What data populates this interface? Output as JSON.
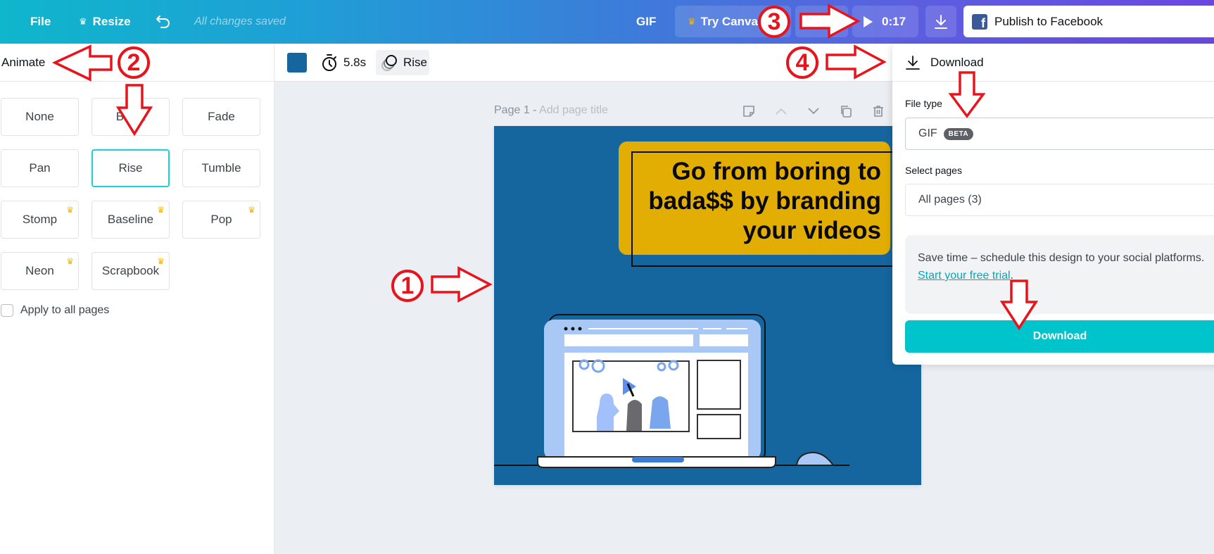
{
  "topbar": {
    "file_label": "File",
    "resize_label": "Resize",
    "save_status": "All changes saved",
    "format_label": "GIF",
    "try_label": "Try Canva Pro",
    "play_time": "0:17",
    "publish_label": "Publish to Facebook",
    "gradient_start": "#0fb6cc",
    "gradient_end": "#6b47e2"
  },
  "left_panel": {
    "title": "Animate",
    "animations": [
      {
        "label": "None",
        "pro": false,
        "selected": false
      },
      {
        "label": "Block",
        "pro": false,
        "selected": false
      },
      {
        "label": "Fade",
        "pro": false,
        "selected": false
      },
      {
        "label": "Pan",
        "pro": false,
        "selected": false
      },
      {
        "label": "Rise",
        "pro": false,
        "selected": true
      },
      {
        "label": "Tumble",
        "pro": false,
        "selected": false
      },
      {
        "label": "Stomp",
        "pro": true,
        "selected": false
      },
      {
        "label": "Baseline",
        "pro": true,
        "selected": false
      },
      {
        "label": "Pop",
        "pro": true,
        "selected": false
      },
      {
        "label": "Neon",
        "pro": true,
        "selected": false
      },
      {
        "label": "Scrapbook",
        "pro": true,
        "selected": false
      }
    ],
    "apply_all_label": "Apply to all pages",
    "apply_all_checked": false,
    "selected_color": "#14d2db"
  },
  "toolbar": {
    "bg_color": "#15669f",
    "duration": "5.8s",
    "animation_label": "Rise"
  },
  "canvas": {
    "page_label": "Page 1 -",
    "page_title_placeholder": "Add page title",
    "headline": "Go from boring to bada$$ by branding your videos",
    "headline_lines": [
      "Go from boring to",
      "bada$$ by branding",
      "your videos"
    ],
    "design_bg": "#15669f",
    "headline_bg": "#e2ae03"
  },
  "download_panel": {
    "title": "Download",
    "file_type_label": "File type",
    "file_type_value": "GIF",
    "file_type_badge": "BETA",
    "select_pages_label": "Select pages",
    "select_pages_value": "All pages (3)",
    "promo_text": "Save time – schedule this design to your social platforms.",
    "promo_link": "Start your free trial",
    "promo_end": ".",
    "download_button": "Download",
    "accent": "#00c4cc"
  },
  "annotations": {
    "numbers": [
      "1",
      "2",
      "3",
      "4"
    ],
    "color": "#e8141c"
  }
}
